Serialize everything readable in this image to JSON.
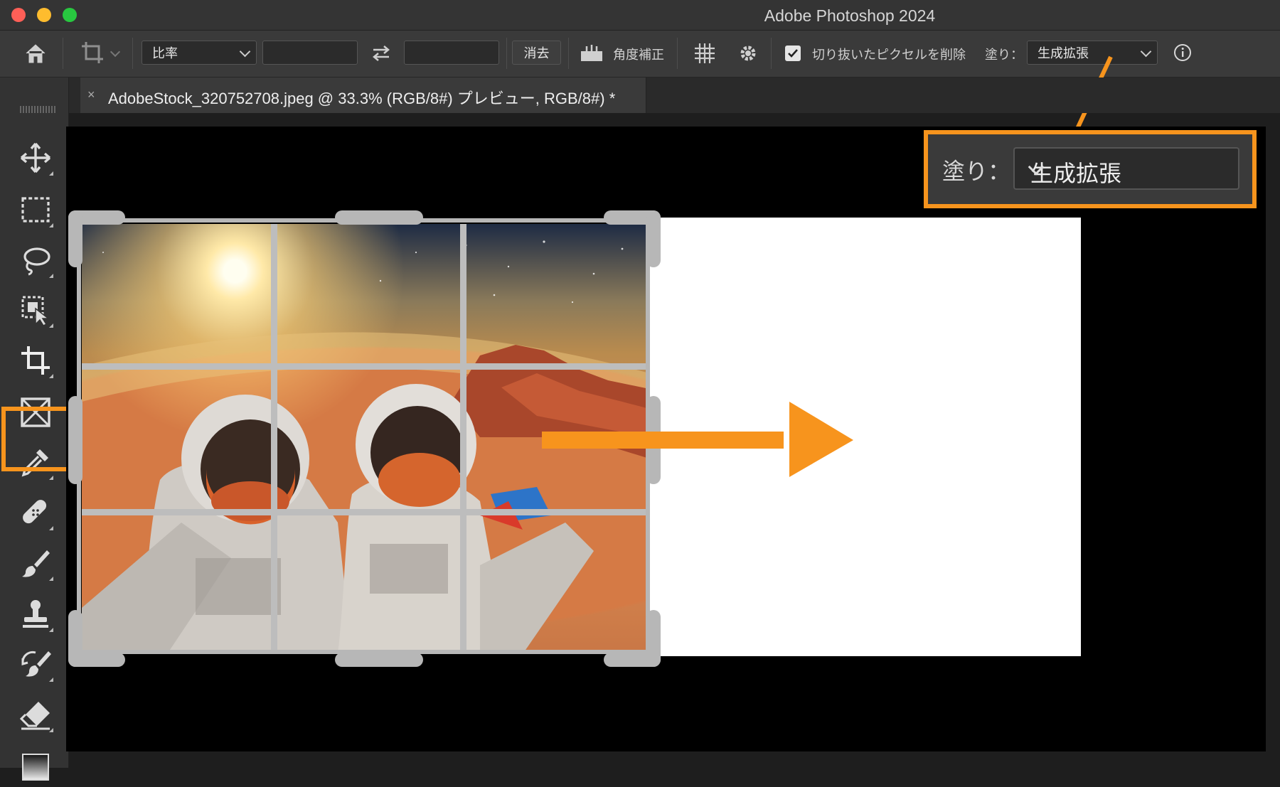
{
  "window": {
    "title": "Adobe Photoshop 2024"
  },
  "options_bar": {
    "ratio_select": "比率",
    "clear_button": "消去",
    "straighten_label": "角度補正",
    "delete_cropped_label": "切り抜いたピクセルを削除",
    "delete_cropped_checked": true,
    "fill_label": "塗り：",
    "fill_select": "生成拡張"
  },
  "document_tab": {
    "close": "×",
    "title": "AdobeStock_320752708.jpeg @ 33.3% (RGB/8#)  プレビュー, RGB/8#) *"
  },
  "panel_toggle": "»",
  "callout": {
    "fill_label": "塗り：",
    "fill_value": "生成拡張"
  },
  "colors": {
    "accent": "#f7941d",
    "canvas_bg": "#000000",
    "ui_bg": "#3a3a3a"
  },
  "tools": [
    "move-icon",
    "marquee-icon",
    "lasso-icon",
    "object-select-icon",
    "crop-icon",
    "frame-icon",
    "eyedropper-icon",
    "healing-icon",
    "brush-icon",
    "stamp-icon",
    "history-brush-icon",
    "eraser-icon",
    "gradient-icon"
  ]
}
